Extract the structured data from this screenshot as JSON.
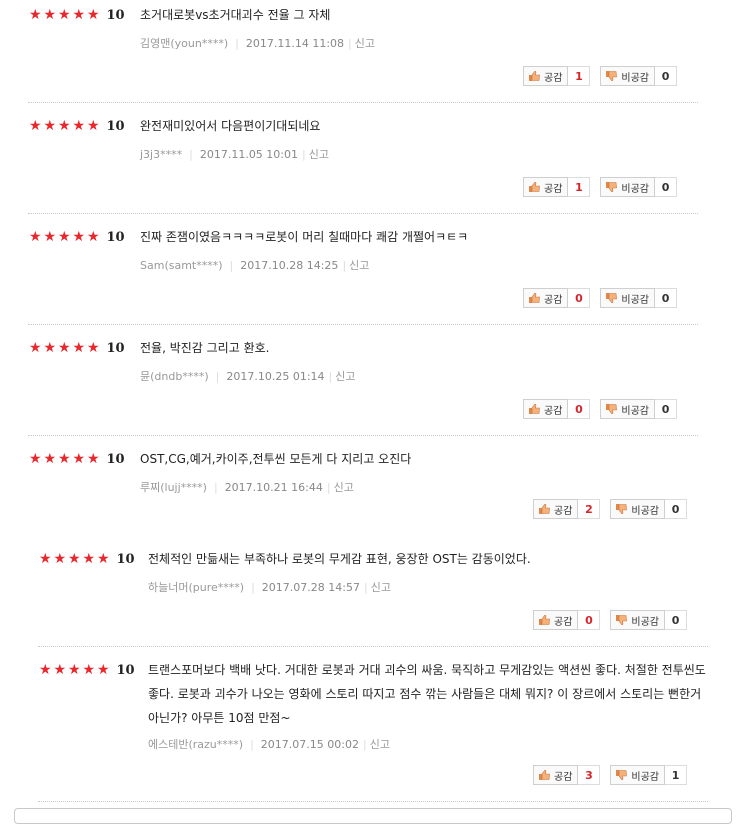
{
  "labels": {
    "like": "공감",
    "dislike": "비공감",
    "report": "신고",
    "star": "★"
  },
  "reviews": [
    {
      "score": "10",
      "text": "초거대로봇vs초거대괴수 전율 그 자체",
      "author": "김영맨(youn****)",
      "date": "2017.11.14 11:08",
      "likes": "1",
      "dislikes": "0"
    },
    {
      "score": "10",
      "text": "완전재미있어서 다음편이기대되네요",
      "author": "j3j3****",
      "date": "2017.11.05 10:01",
      "likes": "1",
      "dislikes": "0"
    },
    {
      "score": "10",
      "text": "진짜 존잼이였음ㅋㅋㅋㅋ로봇이 머리 칠때마다 쾌감 개쩔어ㅋㅌㅋ",
      "author": "Sam(samt****)",
      "date": "2017.10.28 14:25",
      "likes": "0",
      "dislikes": "0"
    },
    {
      "score": "10",
      "text": "전율, 박진감 그리고 환호.",
      "author": "뮨(dndb****)",
      "date": "2017.10.25 01:14",
      "likes": "0",
      "dislikes": "0"
    },
    {
      "score": "10",
      "text": "OST,CG,예거,카이주,전투씬 모든게 다 지리고 오진다",
      "author": "루찌(lujj****)",
      "date": "2017.10.21 16:44",
      "likes": "2",
      "dislikes": "0"
    },
    {
      "score": "10",
      "text": "전체적인 만듦새는 부족하나 로봇의 무게감 표현, 웅장한 OST는 감동이었다.",
      "author": "하늘너머(pure****)",
      "date": "2017.07.28 14:57",
      "likes": "0",
      "dislikes": "0"
    },
    {
      "score": "10",
      "text": "트랜스포머보다 백배 낫다. 거대한 로봇과 거대 괴수의 싸움. 묵직하고 무게감있는 액션씬 좋다. 처절한 전투씬도 좋다. 로봇과 괴수가 나오는 영화에 스토리 따지고 점수 깎는 사람들은 대체 뭐지? 이 장르에서 스토리는 뻔한거 아닌가? 아무튼 10점 만점~",
      "author": "에스테반(razu****)",
      "date": "2017.07.15 00:02",
      "likes": "3",
      "dislikes": "1"
    }
  ]
}
